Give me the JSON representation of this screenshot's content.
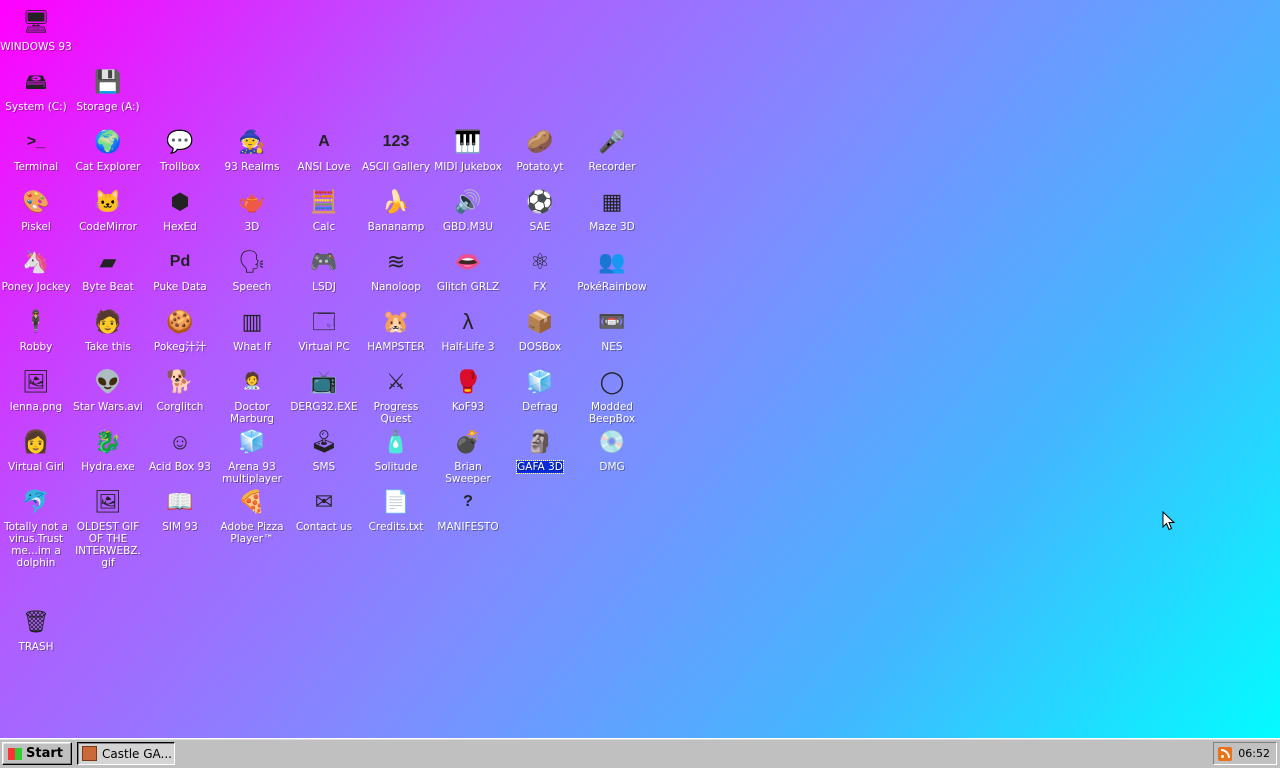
{
  "desktop": {
    "icons": [
      {
        "label": "WINDOWS 93",
        "icon": "computer-icon",
        "glyph": "🖥"
      },
      {
        "label": "System (C:)",
        "icon": "hard-drive-icon",
        "glyph": "🖴"
      },
      {
        "label": "Storage (A:)",
        "icon": "floppy-drive-icon",
        "glyph": "💾"
      },
      {
        "label": "Terminal",
        "icon": "terminal-icon",
        "glyph": ">_"
      },
      {
        "label": "Cat Explorer",
        "icon": "globe-cat-icon",
        "glyph": "🌍"
      },
      {
        "label": "Trollbox",
        "icon": "chat-face-icon",
        "glyph": "💬"
      },
      {
        "label": "93 Realms",
        "icon": "knight-icon",
        "glyph": "🧙"
      },
      {
        "label": "ANSI Love",
        "icon": "letter-a-icon",
        "glyph": "A"
      },
      {
        "label": "ASCII Gallery",
        "icon": "numbers-icon",
        "glyph": "123"
      },
      {
        "label": "MIDI Jukebox",
        "icon": "piano-keys-icon",
        "glyph": "🎹"
      },
      {
        "label": "Potato.yt",
        "icon": "potato-icon",
        "glyph": "🥔"
      },
      {
        "label": "Recorder",
        "icon": "microphone-icon",
        "glyph": "🎤"
      },
      {
        "label": "Piskel",
        "icon": "palette-icon",
        "glyph": "🎨"
      },
      {
        "label": "CodeMirror",
        "icon": "code-cat-icon",
        "glyph": "🐱"
      },
      {
        "label": "HexEd",
        "icon": "cube-icon",
        "glyph": "⬢"
      },
      {
        "label": "3D",
        "icon": "teapot-icon",
        "glyph": "🫖"
      },
      {
        "label": "Calc",
        "icon": "calculator-icon",
        "glyph": "🧮"
      },
      {
        "label": "Bananamp",
        "icon": "banana-icon",
        "glyph": "🍌"
      },
      {
        "label": "GBD.M3U",
        "icon": "audio-file-icon",
        "glyph": "🔊"
      },
      {
        "label": "SAE",
        "icon": "checkered-ball-icon",
        "glyph": "⚽"
      },
      {
        "label": "Maze 3D",
        "icon": "maze-icon",
        "glyph": "▦"
      },
      {
        "label": "Poney Jockey",
        "icon": "pony-icon",
        "glyph": "🦄"
      },
      {
        "label": "Byte Beat",
        "icon": "waveform-icon",
        "glyph": "▰"
      },
      {
        "label": "Puke Data",
        "icon": "pd-icon",
        "glyph": "Pd"
      },
      {
        "label": "Speech",
        "icon": "talking-head-icon",
        "glyph": "🗣"
      },
      {
        "label": "LSDJ",
        "icon": "gameboy-icon",
        "glyph": "🎮"
      },
      {
        "label": "Nanoloop",
        "icon": "wave-lines-icon",
        "glyph": "≋"
      },
      {
        "label": "Glitch GRLZ",
        "icon": "lips-icon",
        "glyph": "👄"
      },
      {
        "label": "FX",
        "icon": "atom-icon",
        "glyph": "⚛"
      },
      {
        "label": "PokéRainbow",
        "icon": "pixel-people-icon",
        "glyph": "👥"
      },
      {
        "label": "Robby",
        "icon": "stick-figure-icon",
        "glyph": "🕴"
      },
      {
        "label": "Take this",
        "icon": "pixel-character-icon",
        "glyph": "🧑"
      },
      {
        "label": "Pokeg汁汁",
        "icon": "cookie-icon",
        "glyph": "🍪"
      },
      {
        "label": "What If",
        "icon": "grid-icon",
        "glyph": "▥"
      },
      {
        "label": "Virtual PC",
        "icon": "window-icon",
        "glyph": "🗔"
      },
      {
        "label": "HAMPSTER",
        "icon": "hamster-icon",
        "glyph": "🐹"
      },
      {
        "label": "Half-Life 3",
        "icon": "lambda-icon",
        "glyph": "λ"
      },
      {
        "label": "DOSBox",
        "icon": "dosbox-icon",
        "glyph": "📦"
      },
      {
        "label": "NES",
        "icon": "nes-console-icon",
        "glyph": "📼"
      },
      {
        "label": "lenna.png",
        "icon": "image-file-icon",
        "glyph": "🖼"
      },
      {
        "label": "Star Wars.avi",
        "icon": "yoda-icon",
        "glyph": "👽"
      },
      {
        "label": "Corglitch",
        "icon": "corgi-icon",
        "glyph": "🐕"
      },
      {
        "label": "Doctor Marburg",
        "icon": "doctor-icon",
        "glyph": "🧑‍⚕"
      },
      {
        "label": "DERG32.EXE",
        "icon": "monitor-face-icon",
        "glyph": "📺"
      },
      {
        "label": "Progress Quest",
        "icon": "crossed-swords-icon",
        "glyph": "⚔"
      },
      {
        "label": "KoF93",
        "icon": "fighter-icon",
        "glyph": "🥊"
      },
      {
        "label": "Defrag",
        "icon": "defrag-icon",
        "glyph": "🧊"
      },
      {
        "label": "Modded BeepBox",
        "icon": "green-ring-icon",
        "glyph": "◯"
      },
      {
        "label": "Virtual Girl",
        "icon": "face-icon",
        "glyph": "👩"
      },
      {
        "label": "Hydra.exe",
        "icon": "dragon-icon",
        "glyph": "🐉"
      },
      {
        "label": "Acid Box 93",
        "icon": "smiley-icon",
        "glyph": "☺"
      },
      {
        "label": "Arena 93 multiplayer",
        "icon": "colored-cube-icon",
        "glyph": "🧊"
      },
      {
        "label": "SMS",
        "icon": "console-icon",
        "glyph": "🕹"
      },
      {
        "label": "Solitude",
        "icon": "bottle-icon",
        "glyph": "🧴"
      },
      {
        "label": "Brian Sweeper",
        "icon": "mine-icon",
        "glyph": "💣"
      },
      {
        "label": "GAFA 3D",
        "icon": "blue-head-icon",
        "glyph": "🗿"
      },
      {
        "label": "DMG",
        "icon": "cartridge-icon",
        "glyph": "💿"
      },
      {
        "label": "Totally not a virus.Trust me...im a dolphin",
        "icon": "dolphin-icon",
        "glyph": "🐬"
      },
      {
        "label": "OLDEST GIF OF THE INTERWEBZ.gif",
        "icon": "gif-file-icon",
        "glyph": "🖼"
      },
      {
        "label": "SIM 93",
        "icon": "book-icon",
        "glyph": "📖"
      },
      {
        "label": "Adobe Pizza Player™",
        "icon": "pizza-icon",
        "glyph": "🍕"
      },
      {
        "label": "Contact us",
        "icon": "letter-pen-icon",
        "glyph": "✉"
      },
      {
        "label": "Credits.txt",
        "icon": "text-file-icon",
        "glyph": "📄"
      },
      {
        "label": "MANIFESTO",
        "icon": "question-mark-icon",
        "glyph": "?"
      },
      {
        "label": "TRASH",
        "icon": "recycle-bin-icon",
        "glyph": "🗑"
      }
    ],
    "selected": "GAFA 3D"
  },
  "taskbar": {
    "start_label": "Start",
    "tasks": [
      {
        "label": "Castle GA..."
      }
    ],
    "clock": "06:52"
  }
}
